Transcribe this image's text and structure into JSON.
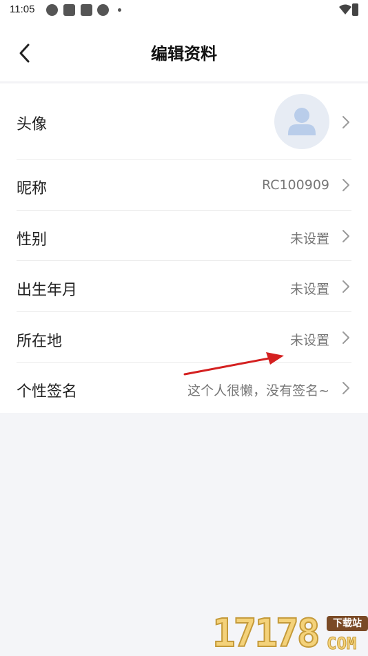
{
  "status_bar": {
    "time": "11:05",
    "icons": [
      "basketball-icon",
      "app-square-icon",
      "app-square-icon",
      "basketball-icon",
      "notification-dot-icon",
      "wifi-icon",
      "battery-charging-icon"
    ]
  },
  "header": {
    "back_icon": "chevron-left-icon",
    "title": "编辑资料"
  },
  "profile": {
    "rows": [
      {
        "label": "头像",
        "value": "",
        "icon": "avatar-placeholder-icon"
      },
      {
        "label": "昵称",
        "value": "RC100909"
      },
      {
        "label": "性别",
        "value": "未设置"
      },
      {
        "label": "出生年月",
        "value": "未设置"
      },
      {
        "label": "所在地",
        "value": "未设置"
      },
      {
        "label": "个性签名",
        "value": "这个人很懒，没有签名~"
      }
    ]
  },
  "colors": {
    "background": "#f4f5f8",
    "card": "#ffffff",
    "value_text": "#777777",
    "avatar_bg": "#e7ecf4",
    "avatar_fg": "#b9cdea",
    "annotation_arrow": "#d42020"
  },
  "watermark": {
    "digits": "17178",
    "badge": "下载站",
    "suffix": "COM"
  }
}
